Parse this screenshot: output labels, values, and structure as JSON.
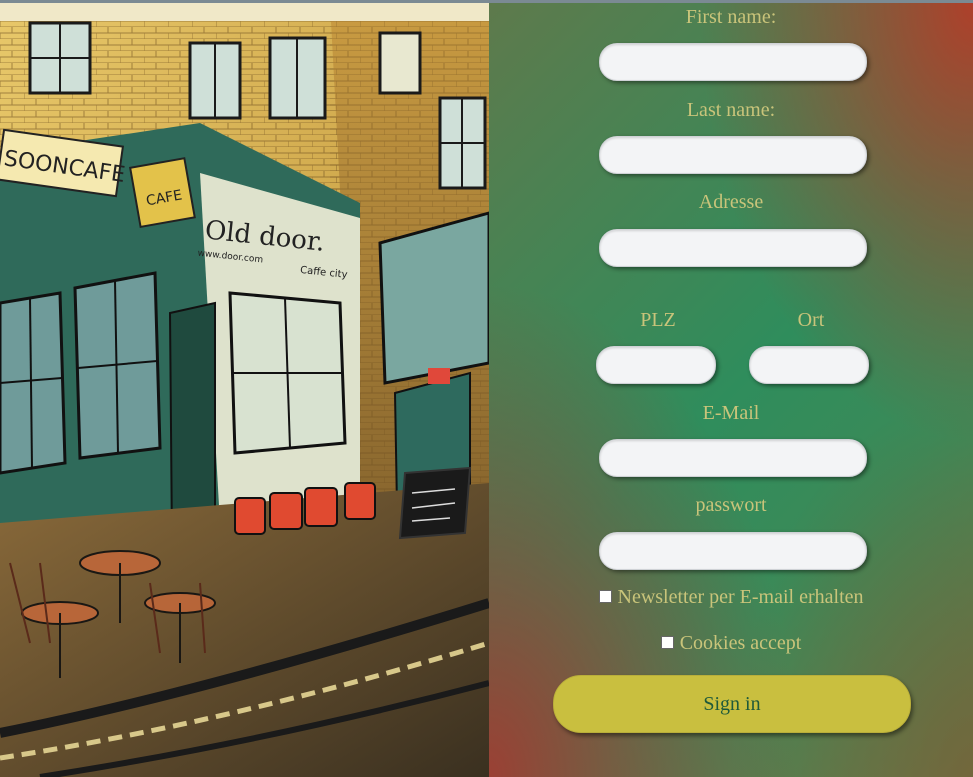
{
  "form": {
    "first_name_label": "First name:",
    "last_name_label": "Last name:",
    "address_label": "Adresse",
    "plz_label": "PLZ",
    "ort_label": "Ort",
    "email_label": "E-Mail",
    "password_label": "passwort",
    "newsletter_label": "Newsletter per E-mail erhalten",
    "cookies_label": "Cookies accept",
    "submit_label": "Sign in"
  },
  "illustration": {
    "sign_1": "SOONCAFE",
    "sign_2": "CAFE",
    "sign_3": "Old door.",
    "sign_4": "www.door.com",
    "sign_5": "Caffe city"
  },
  "colors": {
    "label_text": "#c9c47a",
    "button_bg": "#c9bf3f",
    "button_text": "#1f5a3a"
  }
}
